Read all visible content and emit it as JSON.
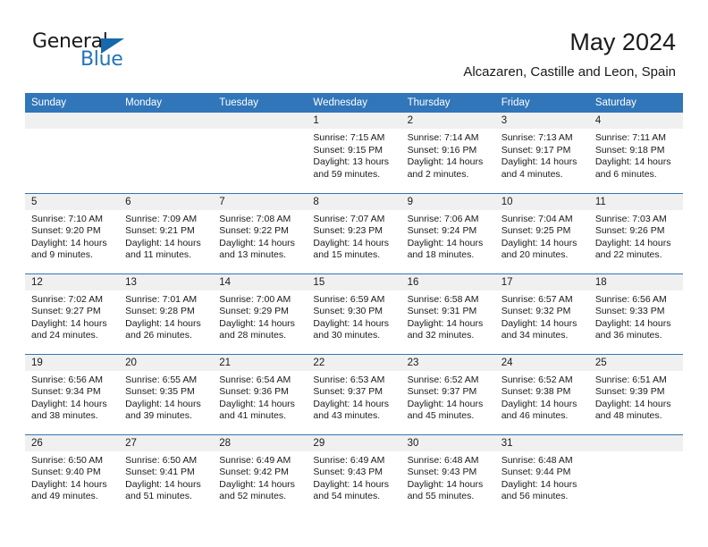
{
  "brand": {
    "name_part1": "General",
    "name_part2": "Blue",
    "accent_color": "#2275bb",
    "triangle_color": "#1769ac"
  },
  "header": {
    "title": "May 2024",
    "subtitle": "Alcazaren, Castille and Leon, Spain"
  },
  "calendar": {
    "header_bg": "#3176b9",
    "daynum_bg": "#f0f0f0",
    "weekday_headers": [
      "Sunday",
      "Monday",
      "Tuesday",
      "Wednesday",
      "Thursday",
      "Friday",
      "Saturday"
    ],
    "weeks": [
      [
        {
          "day": "",
          "sunrise": "",
          "sunset": "",
          "daylight1": "",
          "daylight2": ""
        },
        {
          "day": "",
          "sunrise": "",
          "sunset": "",
          "daylight1": "",
          "daylight2": ""
        },
        {
          "day": "",
          "sunrise": "",
          "sunset": "",
          "daylight1": "",
          "daylight2": ""
        },
        {
          "day": "1",
          "sunrise": "Sunrise: 7:15 AM",
          "sunset": "Sunset: 9:15 PM",
          "daylight1": "Daylight: 13 hours",
          "daylight2": "and 59 minutes."
        },
        {
          "day": "2",
          "sunrise": "Sunrise: 7:14 AM",
          "sunset": "Sunset: 9:16 PM",
          "daylight1": "Daylight: 14 hours",
          "daylight2": "and 2 minutes."
        },
        {
          "day": "3",
          "sunrise": "Sunrise: 7:13 AM",
          "sunset": "Sunset: 9:17 PM",
          "daylight1": "Daylight: 14 hours",
          "daylight2": "and 4 minutes."
        },
        {
          "day": "4",
          "sunrise": "Sunrise: 7:11 AM",
          "sunset": "Sunset: 9:18 PM",
          "daylight1": "Daylight: 14 hours",
          "daylight2": "and 6 minutes."
        }
      ],
      [
        {
          "day": "5",
          "sunrise": "Sunrise: 7:10 AM",
          "sunset": "Sunset: 9:20 PM",
          "daylight1": "Daylight: 14 hours",
          "daylight2": "and 9 minutes."
        },
        {
          "day": "6",
          "sunrise": "Sunrise: 7:09 AM",
          "sunset": "Sunset: 9:21 PM",
          "daylight1": "Daylight: 14 hours",
          "daylight2": "and 11 minutes."
        },
        {
          "day": "7",
          "sunrise": "Sunrise: 7:08 AM",
          "sunset": "Sunset: 9:22 PM",
          "daylight1": "Daylight: 14 hours",
          "daylight2": "and 13 minutes."
        },
        {
          "day": "8",
          "sunrise": "Sunrise: 7:07 AM",
          "sunset": "Sunset: 9:23 PM",
          "daylight1": "Daylight: 14 hours",
          "daylight2": "and 15 minutes."
        },
        {
          "day": "9",
          "sunrise": "Sunrise: 7:06 AM",
          "sunset": "Sunset: 9:24 PM",
          "daylight1": "Daylight: 14 hours",
          "daylight2": "and 18 minutes."
        },
        {
          "day": "10",
          "sunrise": "Sunrise: 7:04 AM",
          "sunset": "Sunset: 9:25 PM",
          "daylight1": "Daylight: 14 hours",
          "daylight2": "and 20 minutes."
        },
        {
          "day": "11",
          "sunrise": "Sunrise: 7:03 AM",
          "sunset": "Sunset: 9:26 PM",
          "daylight1": "Daylight: 14 hours",
          "daylight2": "and 22 minutes."
        }
      ],
      [
        {
          "day": "12",
          "sunrise": "Sunrise: 7:02 AM",
          "sunset": "Sunset: 9:27 PM",
          "daylight1": "Daylight: 14 hours",
          "daylight2": "and 24 minutes."
        },
        {
          "day": "13",
          "sunrise": "Sunrise: 7:01 AM",
          "sunset": "Sunset: 9:28 PM",
          "daylight1": "Daylight: 14 hours",
          "daylight2": "and 26 minutes."
        },
        {
          "day": "14",
          "sunrise": "Sunrise: 7:00 AM",
          "sunset": "Sunset: 9:29 PM",
          "daylight1": "Daylight: 14 hours",
          "daylight2": "and 28 minutes."
        },
        {
          "day": "15",
          "sunrise": "Sunrise: 6:59 AM",
          "sunset": "Sunset: 9:30 PM",
          "daylight1": "Daylight: 14 hours",
          "daylight2": "and 30 minutes."
        },
        {
          "day": "16",
          "sunrise": "Sunrise: 6:58 AM",
          "sunset": "Sunset: 9:31 PM",
          "daylight1": "Daylight: 14 hours",
          "daylight2": "and 32 minutes."
        },
        {
          "day": "17",
          "sunrise": "Sunrise: 6:57 AM",
          "sunset": "Sunset: 9:32 PM",
          "daylight1": "Daylight: 14 hours",
          "daylight2": "and 34 minutes."
        },
        {
          "day": "18",
          "sunrise": "Sunrise: 6:56 AM",
          "sunset": "Sunset: 9:33 PM",
          "daylight1": "Daylight: 14 hours",
          "daylight2": "and 36 minutes."
        }
      ],
      [
        {
          "day": "19",
          "sunrise": "Sunrise: 6:56 AM",
          "sunset": "Sunset: 9:34 PM",
          "daylight1": "Daylight: 14 hours",
          "daylight2": "and 38 minutes."
        },
        {
          "day": "20",
          "sunrise": "Sunrise: 6:55 AM",
          "sunset": "Sunset: 9:35 PM",
          "daylight1": "Daylight: 14 hours",
          "daylight2": "and 39 minutes."
        },
        {
          "day": "21",
          "sunrise": "Sunrise: 6:54 AM",
          "sunset": "Sunset: 9:36 PM",
          "daylight1": "Daylight: 14 hours",
          "daylight2": "and 41 minutes."
        },
        {
          "day": "22",
          "sunrise": "Sunrise: 6:53 AM",
          "sunset": "Sunset: 9:37 PM",
          "daylight1": "Daylight: 14 hours",
          "daylight2": "and 43 minutes."
        },
        {
          "day": "23",
          "sunrise": "Sunrise: 6:52 AM",
          "sunset": "Sunset: 9:37 PM",
          "daylight1": "Daylight: 14 hours",
          "daylight2": "and 45 minutes."
        },
        {
          "day": "24",
          "sunrise": "Sunrise: 6:52 AM",
          "sunset": "Sunset: 9:38 PM",
          "daylight1": "Daylight: 14 hours",
          "daylight2": "and 46 minutes."
        },
        {
          "day": "25",
          "sunrise": "Sunrise: 6:51 AM",
          "sunset": "Sunset: 9:39 PM",
          "daylight1": "Daylight: 14 hours",
          "daylight2": "and 48 minutes."
        }
      ],
      [
        {
          "day": "26",
          "sunrise": "Sunrise: 6:50 AM",
          "sunset": "Sunset: 9:40 PM",
          "daylight1": "Daylight: 14 hours",
          "daylight2": "and 49 minutes."
        },
        {
          "day": "27",
          "sunrise": "Sunrise: 6:50 AM",
          "sunset": "Sunset: 9:41 PM",
          "daylight1": "Daylight: 14 hours",
          "daylight2": "and 51 minutes."
        },
        {
          "day": "28",
          "sunrise": "Sunrise: 6:49 AM",
          "sunset": "Sunset: 9:42 PM",
          "daylight1": "Daylight: 14 hours",
          "daylight2": "and 52 minutes."
        },
        {
          "day": "29",
          "sunrise": "Sunrise: 6:49 AM",
          "sunset": "Sunset: 9:43 PM",
          "daylight1": "Daylight: 14 hours",
          "daylight2": "and 54 minutes."
        },
        {
          "day": "30",
          "sunrise": "Sunrise: 6:48 AM",
          "sunset": "Sunset: 9:43 PM",
          "daylight1": "Daylight: 14 hours",
          "daylight2": "and 55 minutes."
        },
        {
          "day": "31",
          "sunrise": "Sunrise: 6:48 AM",
          "sunset": "Sunset: 9:44 PM",
          "daylight1": "Daylight: 14 hours",
          "daylight2": "and 56 minutes."
        },
        {
          "day": "",
          "sunrise": "",
          "sunset": "",
          "daylight1": "",
          "daylight2": ""
        }
      ]
    ]
  }
}
